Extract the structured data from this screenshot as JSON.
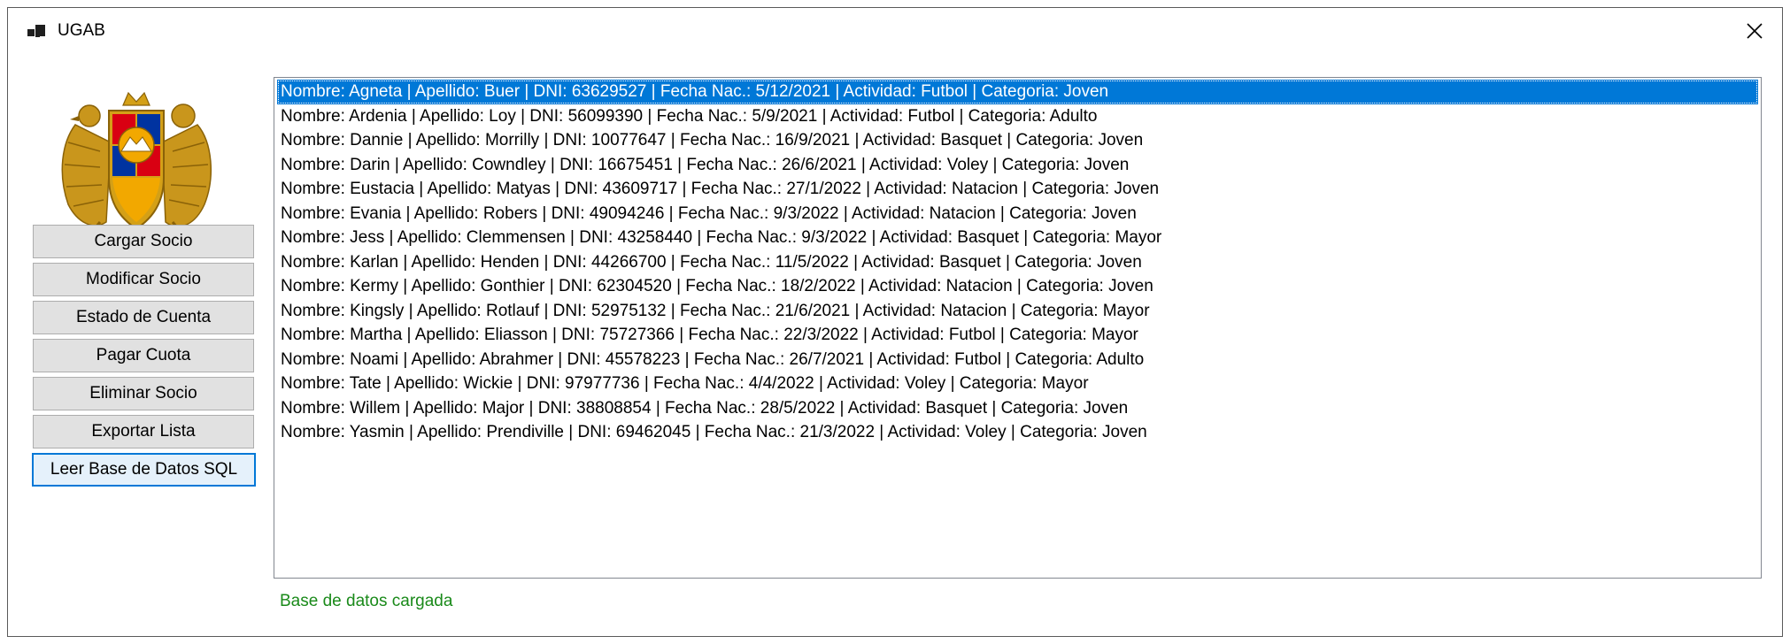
{
  "window": {
    "title": "UGAB",
    "close_glyph": "✕"
  },
  "logo": {
    "icon": "armenia-coat-of-arms",
    "colors": {
      "gold": "#d4a017",
      "red": "#d90012",
      "blue": "#0033a0",
      "orange": "#f2a800"
    }
  },
  "buttons": [
    {
      "label": "Cargar Socio"
    },
    {
      "label": "Modificar Socio"
    },
    {
      "label": "Estado de Cuenta"
    },
    {
      "label": "Pagar Cuota"
    },
    {
      "label": "Eliminar Socio"
    },
    {
      "label": "Exportar Lista"
    },
    {
      "label": "Leer Base de Datos SQL"
    }
  ],
  "list": {
    "selected_index": 0,
    "items": [
      "Nombre: Agneta | Apellido: Buer | DNI: 63629527 | Fecha Nac.: 5/12/2021  | Actividad: Futbol  | Categoria: Joven",
      "Nombre: Ardenia | Apellido: Loy | DNI: 56099390 | Fecha Nac.: 5/9/2021  | Actividad: Futbol  | Categoria: Adulto",
      "Nombre: Dannie | Apellido: Morrilly | DNI: 10077647 | Fecha Nac.: 16/9/2021  | Actividad: Basquet  | Categoria: Joven",
      "Nombre: Darin | Apellido: Cowndley | DNI: 16675451 | Fecha Nac.: 26/6/2021  | Actividad: Voley  | Categoria: Joven",
      "Nombre: Eustacia | Apellido: Matyas | DNI: 43609717 | Fecha Nac.: 27/1/2022  | Actividad: Natacion  | Categoria: Joven",
      "Nombre: Evania | Apellido: Robers | DNI: 49094246 | Fecha Nac.: 9/3/2022  | Actividad: Natacion  | Categoria: Joven",
      "Nombre: Jess | Apellido: Clemmensen | DNI: 43258440 | Fecha Nac.: 9/3/2022  | Actividad: Basquet  | Categoria: Mayor",
      "Nombre: Karlan | Apellido: Henden | DNI: 44266700 | Fecha Nac.: 11/5/2022  | Actividad: Basquet  | Categoria: Joven",
      "Nombre: Kermy | Apellido: Gonthier | DNI: 62304520 | Fecha Nac.: 18/2/2022  | Actividad: Natacion  | Categoria: Joven",
      "Nombre: Kingsly | Apellido: Rotlauf | DNI: 52975132 | Fecha Nac.: 21/6/2021  | Actividad: Natacion  | Categoria: Mayor",
      "Nombre: Martha | Apellido: Eliasson | DNI: 75727366 | Fecha Nac.: 22/3/2022  | Actividad: Futbol  | Categoria: Mayor",
      "Nombre: Noami | Apellido: Abrahmer | DNI: 45578223 | Fecha Nac.: 26/7/2021  | Actividad: Futbol  | Categoria: Adulto",
      "Nombre: Tate | Apellido: Wickie | DNI: 97977736 | Fecha Nac.: 4/4/2022  | Actividad: Voley  | Categoria: Mayor",
      "Nombre: Willem | Apellido: Major | DNI: 38808854 | Fecha Nac.: 28/5/2022  | Actividad: Basquet  | Categoria: Joven",
      "Nombre: Yasmin | Apellido: Prendiville | DNI: 69462045 | Fecha Nac.: 21/3/2022  | Actividad: Voley  | Categoria: Joven"
    ]
  },
  "status": {
    "text": "Base de datos cargada",
    "color": "#1a8a1a"
  }
}
